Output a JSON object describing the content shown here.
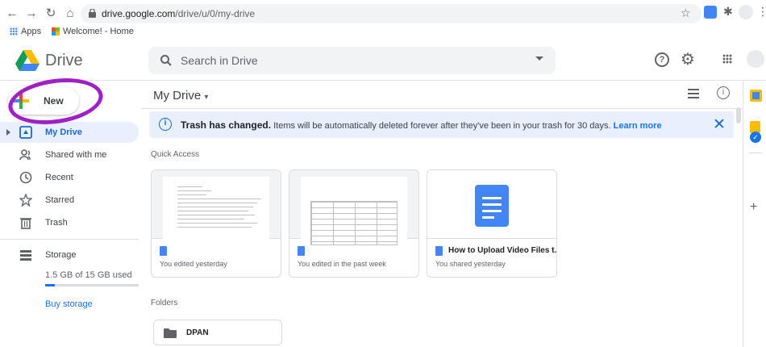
{
  "browser": {
    "url_domain": "drive.google.com",
    "url_path": "/drive/u/0/my-drive",
    "bookmarks": [
      "Apps",
      "Welcome! - Home"
    ]
  },
  "app": {
    "name": "Drive",
    "search_placeholder": "Search in Drive"
  },
  "sidebar": {
    "new_label": "New",
    "items": [
      {
        "label": "My Drive",
        "icon": "my-drive-icon"
      },
      {
        "label": "Shared with me",
        "icon": "shared-icon"
      },
      {
        "label": "Recent",
        "icon": "clock-icon"
      },
      {
        "label": "Starred",
        "icon": "star-icon"
      },
      {
        "label": "Trash",
        "icon": "trash-icon"
      },
      {
        "label": "Storage",
        "icon": "storage-icon"
      }
    ],
    "storage_used_text": "1.5 GB of 15 GB used",
    "storage_fraction": 0.1,
    "buy_storage": "Buy storage"
  },
  "main": {
    "title": "My Drive",
    "banner": {
      "bold": "Trash has changed.",
      "text": "Items will be automatically deleted forever after they've been in your trash for 30 days.",
      "link": "Learn more"
    },
    "quick_access_label": "Quick Access",
    "cards": [
      {
        "name": "",
        "caption": "You edited yesterday"
      },
      {
        "name": "",
        "caption": "You edited in the past week"
      },
      {
        "name": "How to Upload Video Files t...",
        "caption": "You shared yesterday"
      }
    ],
    "folders_label": "Folders",
    "folders": [
      {
        "name": "DPAN"
      }
    ]
  },
  "colors": {
    "accent": "#1a73e8",
    "active_bg": "#e8f0fe",
    "annotation": "#a020c8",
    "doc_blue": "#4285f4"
  }
}
